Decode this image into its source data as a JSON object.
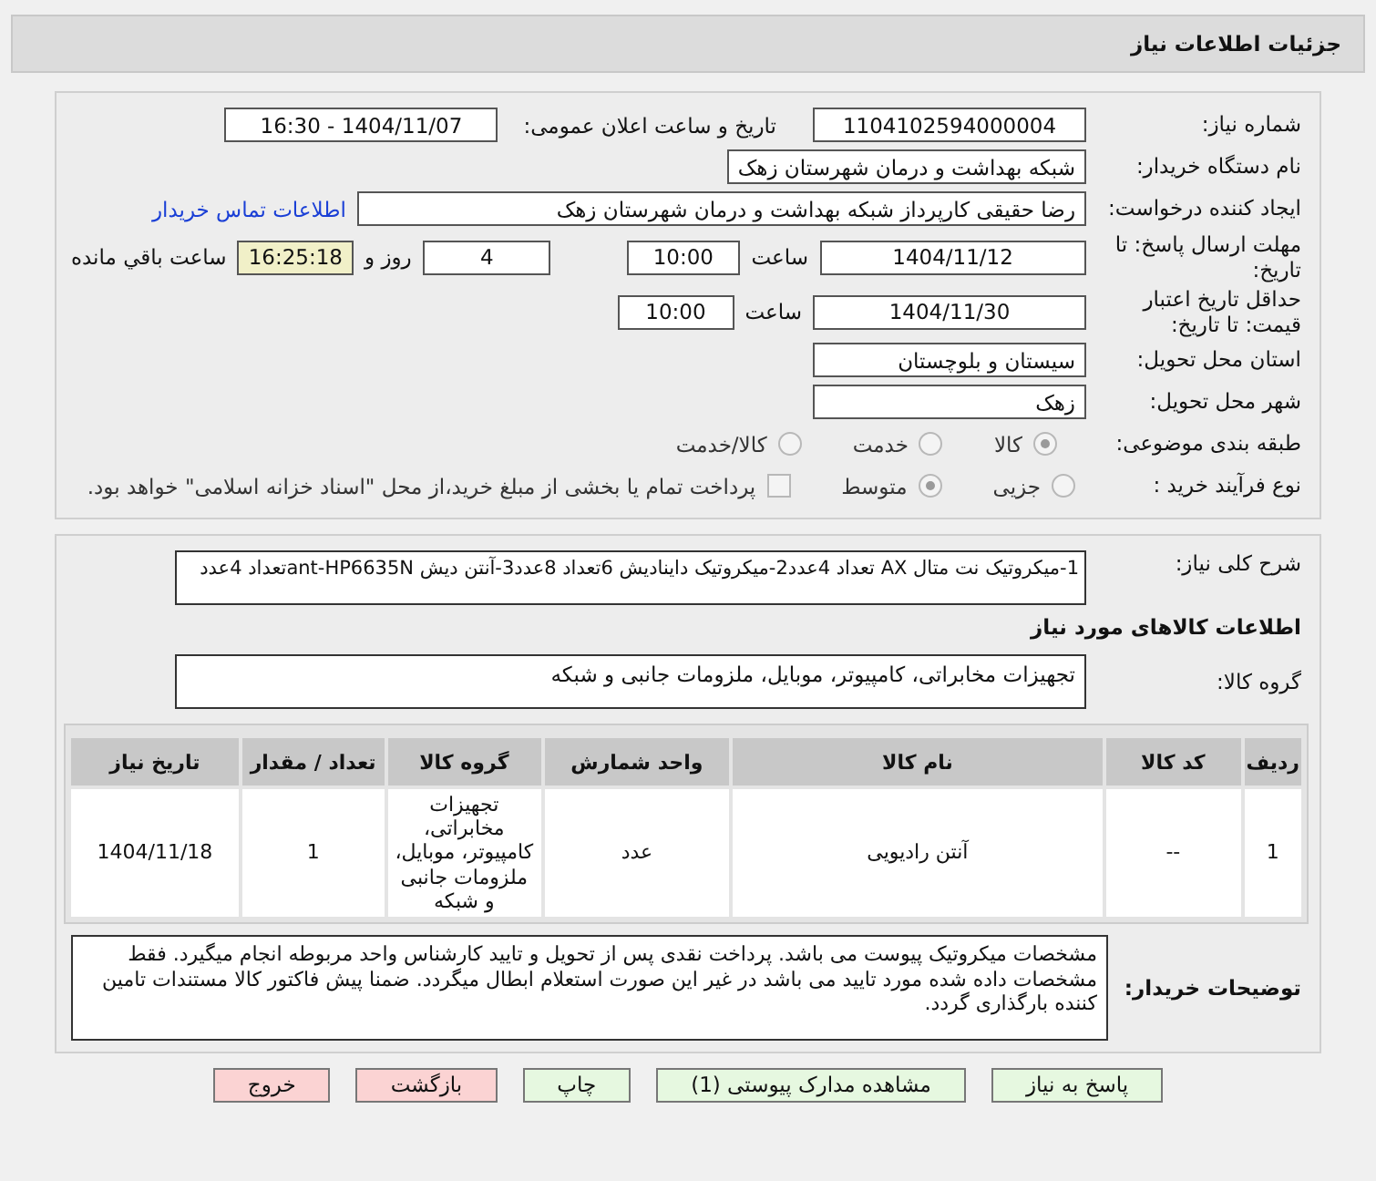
{
  "header": {
    "title": "جزئیات اطلاعات نیاز"
  },
  "need_number": {
    "label": "شماره نیاز:",
    "value": "1104102594000004"
  },
  "announce": {
    "label": "تاریخ و ساعت اعلان عمومی:",
    "value": "1404/11/07 - 16:30"
  },
  "buyer": {
    "label": "نام دستگاه خریدار:",
    "value": "شبکه بهداشت و درمان شهرستان زهک"
  },
  "creator": {
    "label": "ایجاد کننده درخواست:",
    "value": "رضا حقیقی کارپرداز شبکه بهداشت و درمان شهرستان زهک",
    "link": "اطلاعات تماس خریدار"
  },
  "deadline": {
    "label": "مهلت ارسال پاسخ: تا تاریخ:",
    "date": "1404/11/12",
    "time_label": "ساعت",
    "time": "10:00",
    "days": "4",
    "days_label": "روز و",
    "remaining": "16:25:18",
    "remaining_label": "ساعت باقي مانده"
  },
  "validity": {
    "label": "حداقل تاریخ اعتبار قیمت: تا تاریخ:",
    "date": "1404/11/30",
    "time_label": "ساعت",
    "time": "10:00"
  },
  "province": {
    "label": "استان محل تحویل:",
    "value": "سیستان و بلوچستان"
  },
  "city": {
    "label": "شهر محل تحویل:",
    "value": "زهک"
  },
  "category": {
    "label": "طبقه بندی موضوعی:",
    "options": [
      {
        "label": "کالا",
        "selected": true
      },
      {
        "label": "خدمت",
        "selected": false
      },
      {
        "label": "کالا/خدمت",
        "selected": false
      }
    ]
  },
  "process": {
    "label": "نوع فرآیند خرید :",
    "options": [
      {
        "label": "جزیی",
        "selected": false
      },
      {
        "label": "متوسط",
        "selected": true
      }
    ],
    "checkbox": {
      "checked": false,
      "label": "پرداخت تمام یا بخشی از مبلغ خرید،از محل \"اسناد خزانه اسلامی\" خواهد بود."
    }
  },
  "description": {
    "label": "شرح کلی نیاز:",
    "value": "1-میکروتیک نت متال AX تعداد 4عدد2-میکروتیک دایناديش 6تعداد 8عدد3-آنتن دیش ant-HP6635Nتعداد 4عدد"
  },
  "goods_title": "اطلاعات کالاهای مورد نیاز",
  "goods_group": {
    "label": "گروه کالا:",
    "value": "تجهیزات مخابراتی، کامپیوتر، موبایل، ملزومات جانبی و شبکه"
  },
  "table": {
    "columns": [
      "ردیف",
      "کد کالا",
      "نام کالا",
      "واحد شمارش",
      "گروه کالا",
      "تعداد / مقدار",
      "تاریخ نیاز"
    ],
    "rows": [
      [
        "1",
        "--",
        "آنتن رادیویی",
        "عدد",
        "تجهیزات مخابراتی، کامپیوتر، موبایل، ملزومات جانبی و شبکه",
        "1",
        "1404/11/18"
      ]
    ]
  },
  "buyer_notes": {
    "label": "توضیحات خریدار:",
    "value": "مشخصات میکروتیک پیوست می باشد. پرداخت نقدی پس از تحویل و تایید کارشناس  واحد مربوطه انجام میگیرد. فقط مشخصات داده شده مورد تایید می باشد در غیر این صورت استعلام ابطال میگردد. ضمنا پیش فاکتور کالا مستندات تامین کننده بارگذاری گردد."
  },
  "buttons": [
    {
      "label": "پاسخ به نیاز",
      "kind": "green"
    },
    {
      "label": "مشاهده مدارک پیوستی (1)",
      "kind": "green"
    },
    {
      "label": "چاپ",
      "kind": "green"
    },
    {
      "label": "بازگشت",
      "kind": "red"
    },
    {
      "label": "خروج",
      "kind": "red"
    }
  ]
}
